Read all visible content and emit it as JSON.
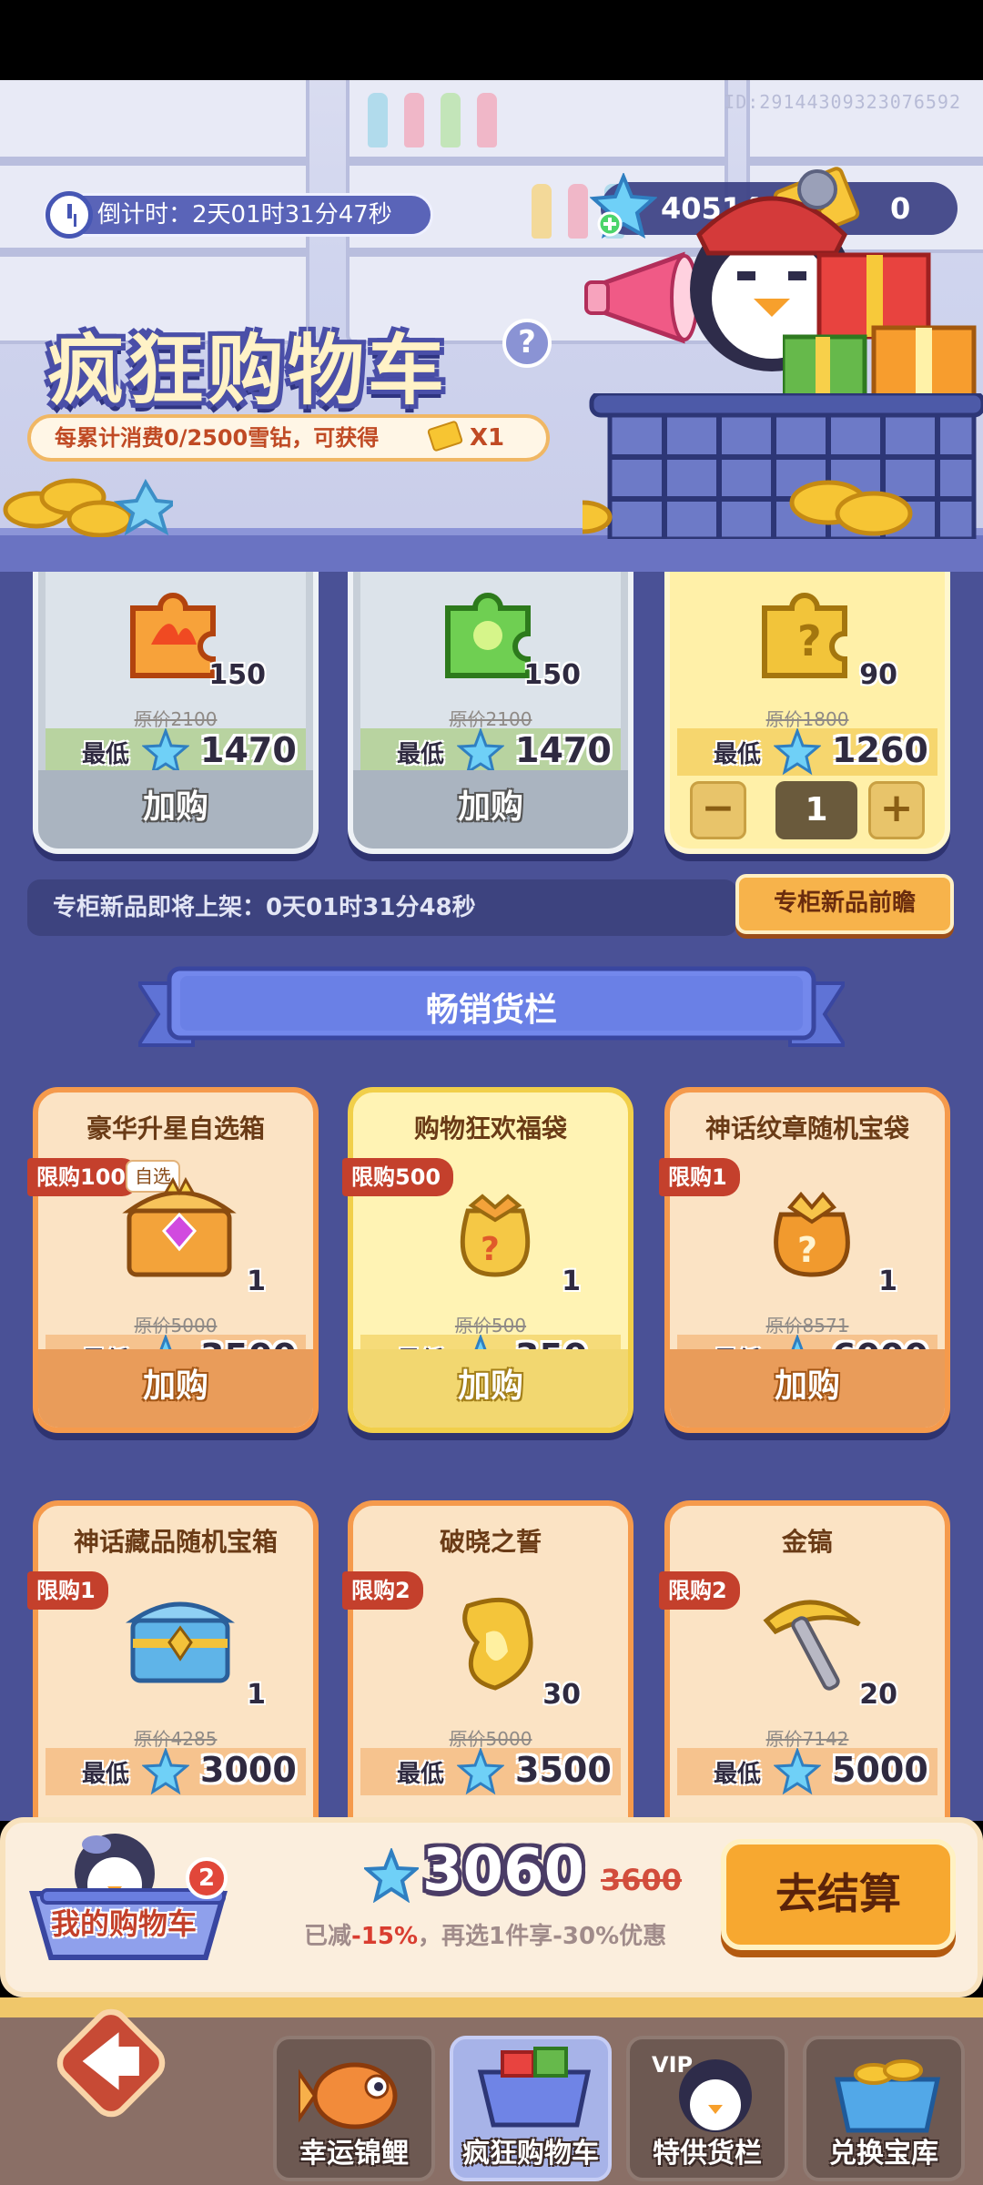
{
  "banner": {
    "uid": "ID:29144309323076592",
    "countdown": "倒计时：2天01时31分47秒",
    "title": "疯狂购物车",
    "help_icon": "?",
    "spend_text": "每累计消费0/2500雪钻，可获得",
    "spend_reward": "X1",
    "diamond_amount": "40514",
    "ticket_amount": "0"
  },
  "top_cards": [
    {
      "qty": "150",
      "orig": "原价2100",
      "low": "最低",
      "price": "1470",
      "btn": "加购"
    },
    {
      "qty": "150",
      "orig": "原价2100",
      "low": "最低",
      "price": "1470",
      "btn": "加购"
    },
    {
      "qty": "90",
      "orig": "原价1800",
      "low": "最低",
      "price": "1260",
      "step_minus": "−",
      "step_value": "1",
      "step_plus": "+"
    }
  ],
  "new_products": {
    "text": "专柜新品即将上架：0天01时31分48秒",
    "button": "专柜新品前瞻"
  },
  "section_title": "畅销货栏",
  "cards": [
    {
      "title": "豪华升星自选箱",
      "limit": "限购100",
      "pick": "自选",
      "qty": "1",
      "orig": "原价5000",
      "low": "最低",
      "price": "3500",
      "btn": "加购"
    },
    {
      "title": "购物狂欢福袋",
      "limit": "限购500",
      "qty": "1",
      "orig": "原价500",
      "low": "最低",
      "price": "350",
      "btn": "加购"
    },
    {
      "title": "神话纹章随机宝袋",
      "limit": "限购1",
      "qty": "1",
      "orig": "原价8571",
      "low": "最低",
      "price": "6000",
      "btn": "加购"
    },
    {
      "title": "神话藏品随机宝箱",
      "limit": "限购1",
      "qty": "1",
      "orig": "原价4285",
      "low": "最低",
      "price": "3000"
    },
    {
      "title": "破晓之誓",
      "limit": "限购2",
      "qty": "30",
      "orig": "原价5000",
      "low": "最低",
      "price": "3500"
    },
    {
      "title": "金镐",
      "limit": "限购2",
      "qty": "20",
      "orig": "原价7142",
      "low": "最低",
      "price": "5000"
    }
  ],
  "checkout": {
    "cart_label": "我的购物车",
    "cart_count": "2",
    "total": "3060",
    "original_total": "3600",
    "note_prefix": "已减",
    "note_discount": "-15%",
    "note_suffix": "，再选1件享-30%优惠",
    "button": "去结算"
  },
  "nav": {
    "back": "🡄",
    "tabs": [
      {
        "label": "幸运锦鲤"
      },
      {
        "label": "疯狂购物车"
      },
      {
        "label": "特供货栏",
        "badge": "VIP"
      },
      {
        "label": "兑换宝库"
      }
    ]
  },
  "colors": {
    "main_bg": "#4a5196",
    "accent_orange": "#f7a830",
    "limit_red": "#c4402c",
    "diamond": "#5bc7f2"
  }
}
